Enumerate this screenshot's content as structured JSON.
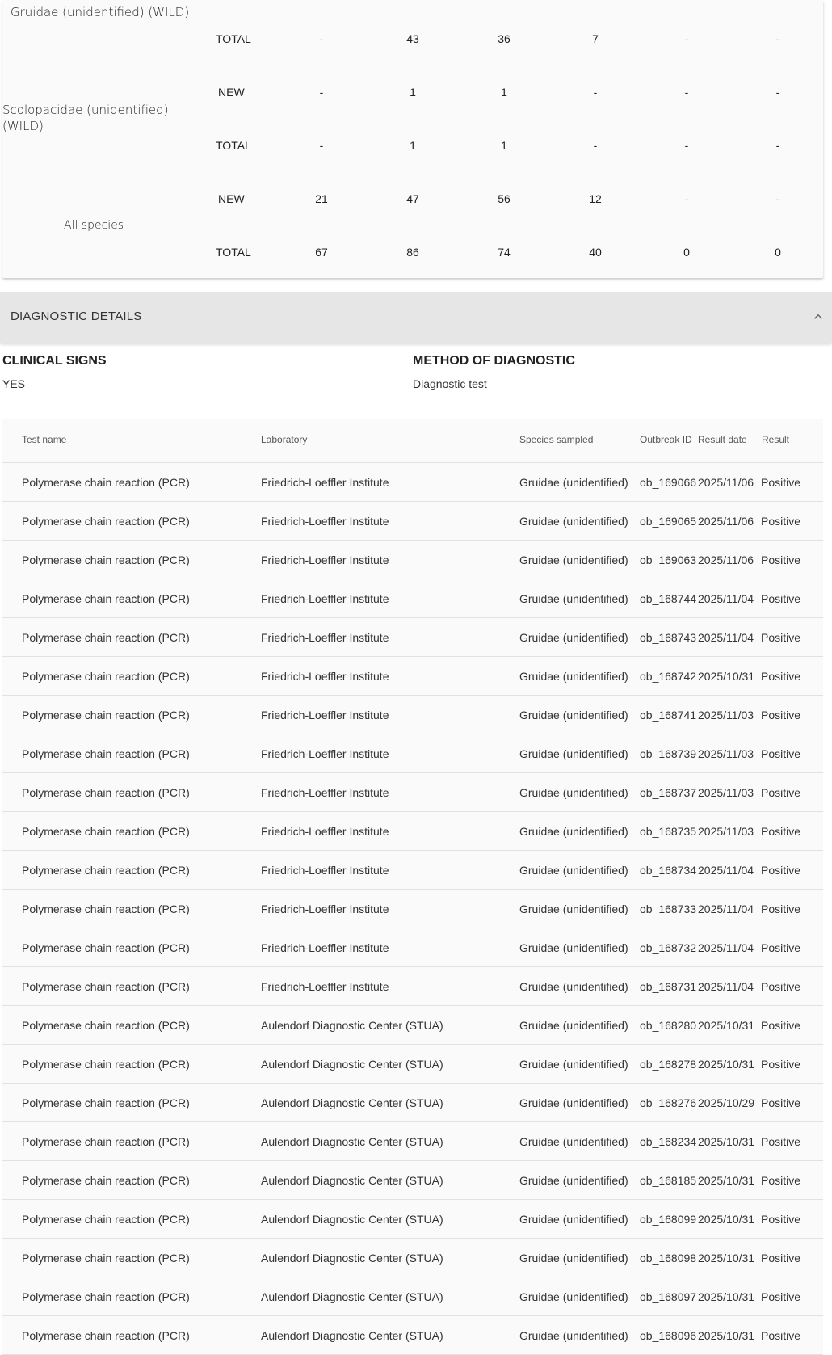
{
  "summary": {
    "species": [
      {
        "name": "Gruidae (unidentified) (WILD)",
        "rows": [
          {
            "type": "TOTAL",
            "values": [
              "-",
              "43",
              "36",
              "7",
              "-",
              "-"
            ]
          }
        ]
      },
      {
        "name": "Scolopacidae (unidentified) (WILD)",
        "rows": [
          {
            "type": "NEW",
            "values": [
              "-",
              "1",
              "1",
              "-",
              "-",
              "-"
            ]
          },
          {
            "type": "TOTAL",
            "values": [
              "-",
              "1",
              "1",
              "-",
              "-",
              "-"
            ]
          }
        ]
      },
      {
        "name": "All species",
        "rows": [
          {
            "type": "NEW",
            "values": [
              "21",
              "47",
              "56",
              "12",
              "-",
              "-"
            ]
          },
          {
            "type": "TOTAL",
            "values": [
              "67",
              "86",
              "74",
              "40",
              "0",
              "0"
            ]
          }
        ]
      }
    ]
  },
  "diagnostic": {
    "title": "DIAGNOSTIC DETAILS",
    "clinical_signs": {
      "label": "CLINICAL SIGNS",
      "value": "YES"
    },
    "method": {
      "label": "METHOD OF DIAGNOSTIC",
      "value": "Diagnostic test"
    },
    "table": {
      "headers": {
        "test": "Test name",
        "lab": "Laboratory",
        "species": "Species sampled",
        "outbreak": "Outbreak ID",
        "date": "Result date",
        "result": "Result"
      },
      "rows": [
        {
          "test": "Polymerase chain reaction (PCR)",
          "lab": "Friedrich-Loeffler Institute",
          "species": "Gruidae (unidentified)",
          "outbreak": "ob_169066",
          "date": "2025/11/06",
          "result": "Positive"
        },
        {
          "test": "Polymerase chain reaction (PCR)",
          "lab": "Friedrich-Loeffler Institute",
          "species": "Gruidae (unidentified)",
          "outbreak": "ob_169065",
          "date": "2025/11/06",
          "result": "Positive"
        },
        {
          "test": "Polymerase chain reaction (PCR)",
          "lab": "Friedrich-Loeffler Institute",
          "species": "Gruidae (unidentified)",
          "outbreak": "ob_169063",
          "date": "2025/11/06",
          "result": "Positive"
        },
        {
          "test": "Polymerase chain reaction (PCR)",
          "lab": "Friedrich-Loeffler Institute",
          "species": "Gruidae (unidentified)",
          "outbreak": "ob_168744",
          "date": "2025/11/04",
          "result": "Positive"
        },
        {
          "test": "Polymerase chain reaction (PCR)",
          "lab": "Friedrich-Loeffler Institute",
          "species": "Gruidae (unidentified)",
          "outbreak": "ob_168743",
          "date": "2025/11/04",
          "result": "Positive"
        },
        {
          "test": "Polymerase chain reaction (PCR)",
          "lab": "Friedrich-Loeffler Institute",
          "species": "Gruidae (unidentified)",
          "outbreak": "ob_168742",
          "date": "2025/10/31",
          "result": "Positive"
        },
        {
          "test": "Polymerase chain reaction (PCR)",
          "lab": "Friedrich-Loeffler Institute",
          "species": "Gruidae (unidentified)",
          "outbreak": "ob_168741",
          "date": "2025/11/03",
          "result": "Positive"
        },
        {
          "test": "Polymerase chain reaction (PCR)",
          "lab": "Friedrich-Loeffler Institute",
          "species": "Gruidae (unidentified)",
          "outbreak": "ob_168739",
          "date": "2025/11/03",
          "result": "Positive"
        },
        {
          "test": "Polymerase chain reaction (PCR)",
          "lab": "Friedrich-Loeffler Institute",
          "species": "Gruidae (unidentified)",
          "outbreak": "ob_168737",
          "date": "2025/11/03",
          "result": "Positive"
        },
        {
          "test": "Polymerase chain reaction (PCR)",
          "lab": "Friedrich-Loeffler Institute",
          "species": "Gruidae (unidentified)",
          "outbreak": "ob_168735",
          "date": "2025/11/03",
          "result": "Positive"
        },
        {
          "test": "Polymerase chain reaction (PCR)",
          "lab": "Friedrich-Loeffler Institute",
          "species": "Gruidae (unidentified)",
          "outbreak": "ob_168734",
          "date": "2025/11/04",
          "result": "Positive"
        },
        {
          "test": "Polymerase chain reaction (PCR)",
          "lab": "Friedrich-Loeffler Institute",
          "species": "Gruidae (unidentified)",
          "outbreak": "ob_168733",
          "date": "2025/11/04",
          "result": "Positive"
        },
        {
          "test": "Polymerase chain reaction (PCR)",
          "lab": "Friedrich-Loeffler Institute",
          "species": "Gruidae (unidentified)",
          "outbreak": "ob_168732",
          "date": "2025/11/04",
          "result": "Positive"
        },
        {
          "test": "Polymerase chain reaction (PCR)",
          "lab": "Friedrich-Loeffler Institute",
          "species": "Gruidae (unidentified)",
          "outbreak": "ob_168731",
          "date": "2025/11/04",
          "result": "Positive"
        },
        {
          "test": "Polymerase chain reaction (PCR)",
          "lab": "Aulendorf Diagnostic Center (STUA)",
          "species": "Gruidae (unidentified)",
          "outbreak": "ob_168280",
          "date": "2025/10/31",
          "result": "Positive"
        },
        {
          "test": "Polymerase chain reaction (PCR)",
          "lab": "Aulendorf Diagnostic Center (STUA)",
          "species": "Gruidae (unidentified)",
          "outbreak": "ob_168278",
          "date": "2025/10/31",
          "result": "Positive"
        },
        {
          "test": "Polymerase chain reaction (PCR)",
          "lab": "Aulendorf Diagnostic Center (STUA)",
          "species": "Gruidae (unidentified)",
          "outbreak": "ob_168276",
          "date": "2025/10/29",
          "result": "Positive"
        },
        {
          "test": "Polymerase chain reaction (PCR)",
          "lab": "Aulendorf Diagnostic Center (STUA)",
          "species": "Gruidae (unidentified)",
          "outbreak": "ob_168234",
          "date": "2025/10/31",
          "result": "Positive"
        },
        {
          "test": "Polymerase chain reaction (PCR)",
          "lab": "Aulendorf Diagnostic Center (STUA)",
          "species": "Gruidae (unidentified)",
          "outbreak": "ob_168185",
          "date": "2025/10/31",
          "result": "Positive"
        },
        {
          "test": "Polymerase chain reaction (PCR)",
          "lab": "Aulendorf Diagnostic Center (STUA)",
          "species": "Gruidae (unidentified)",
          "outbreak": "ob_168099",
          "date": "2025/10/31",
          "result": "Positive"
        },
        {
          "test": "Polymerase chain reaction (PCR)",
          "lab": "Aulendorf Diagnostic Center (STUA)",
          "species": "Gruidae (unidentified)",
          "outbreak": "ob_168098",
          "date": "2025/10/31",
          "result": "Positive"
        },
        {
          "test": "Polymerase chain reaction (PCR)",
          "lab": "Aulendorf Diagnostic Center (STUA)",
          "species": "Gruidae (unidentified)",
          "outbreak": "ob_168097",
          "date": "2025/10/31",
          "result": "Positive"
        },
        {
          "test": "Polymerase chain reaction (PCR)",
          "lab": "Aulendorf Diagnostic Center (STUA)",
          "species": "Gruidae (unidentified)",
          "outbreak": "ob_168096",
          "date": "2025/10/31",
          "result": "Positive"
        }
      ]
    }
  }
}
